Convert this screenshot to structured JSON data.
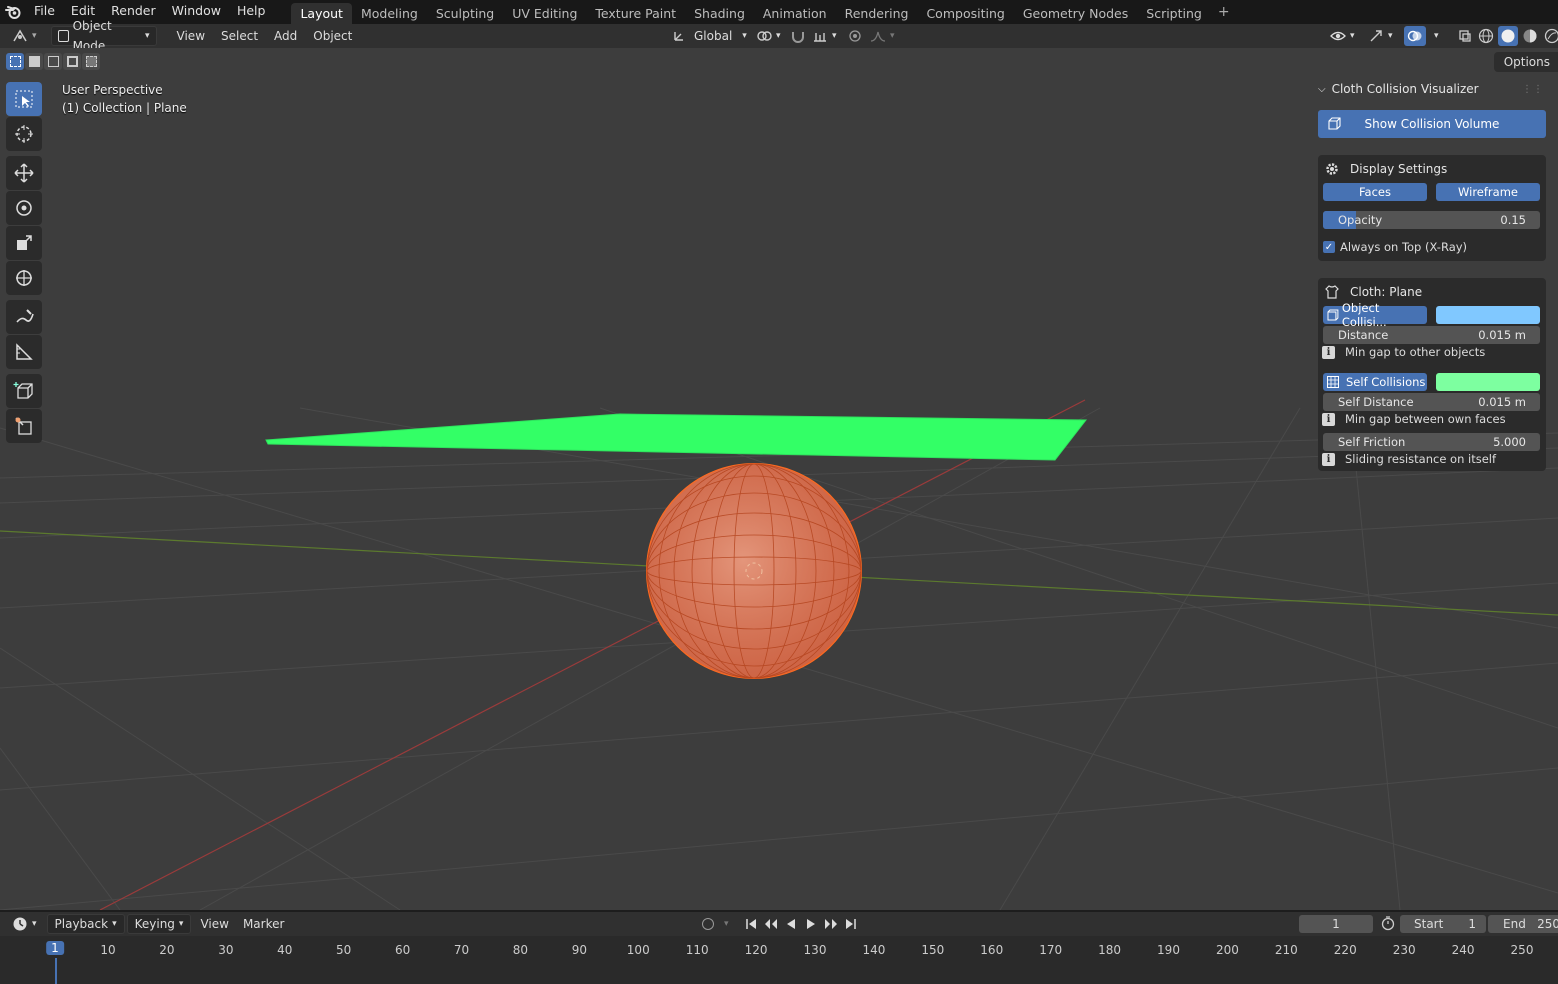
{
  "top_menu": [
    "File",
    "Edit",
    "Render",
    "Window",
    "Help"
  ],
  "workspaces": [
    "Layout",
    "Modeling",
    "Sculpting",
    "UV Editing",
    "Texture Paint",
    "Shading",
    "Animation",
    "Rendering",
    "Compositing",
    "Geometry Nodes",
    "Scripting"
  ],
  "active_workspace": "Layout",
  "header": {
    "mode": "Object Mode",
    "menus": [
      "View",
      "Select",
      "Add",
      "Object"
    ],
    "orientation": "Global"
  },
  "viewport": {
    "perspective": "User Perspective",
    "collection": "(1) Collection | Plane",
    "options_label": "Options"
  },
  "panel": {
    "title": "Cloth Collision Visualizer",
    "show_button": "Show Collision Volume",
    "display": {
      "title": "Display Settings",
      "faces": "Faces",
      "wireframe": "Wireframe",
      "opacity_label": "Opacity",
      "opacity_value": "0.15",
      "opacity_fraction": 0.15,
      "xray_label": "Always on Top (X-Ray)",
      "xray_checked": true
    },
    "cloth": {
      "title": "Cloth: Plane",
      "object_label": "Object Collisi...",
      "object_color": "#80c8ff",
      "distance_label": "Distance",
      "distance_value": "0.015 m",
      "distance_hint": "Min gap to other objects",
      "self_label": "Self Collisions",
      "self_color": "#7dffa0",
      "self_distance_label": "Self Distance",
      "self_distance_value": "0.015 m",
      "self_distance_hint": "Min gap between own faces",
      "self_friction_label": "Self Friction",
      "self_friction_value": "5.000",
      "self_friction_hint": "Sliding resistance on itself"
    }
  },
  "timeline": {
    "menus": [
      "Playback",
      "Keying",
      "View",
      "Marker"
    ],
    "current_frame": "1",
    "start_label": "Start",
    "start_value": "1",
    "end_label": "End",
    "end_value": "250",
    "ticks": [
      "1",
      "10",
      "20",
      "30",
      "40",
      "50",
      "60",
      "70",
      "80",
      "90",
      "100",
      "110",
      "120",
      "130",
      "140",
      "150",
      "160",
      "170",
      "180",
      "190",
      "200",
      "210",
      "220",
      "230",
      "240",
      "250"
    ]
  },
  "colors": {
    "accent": "#4772b3",
    "plane": "#33ff66",
    "sphere": "#e8643c",
    "viewport_bg": "#3d3d3d"
  }
}
